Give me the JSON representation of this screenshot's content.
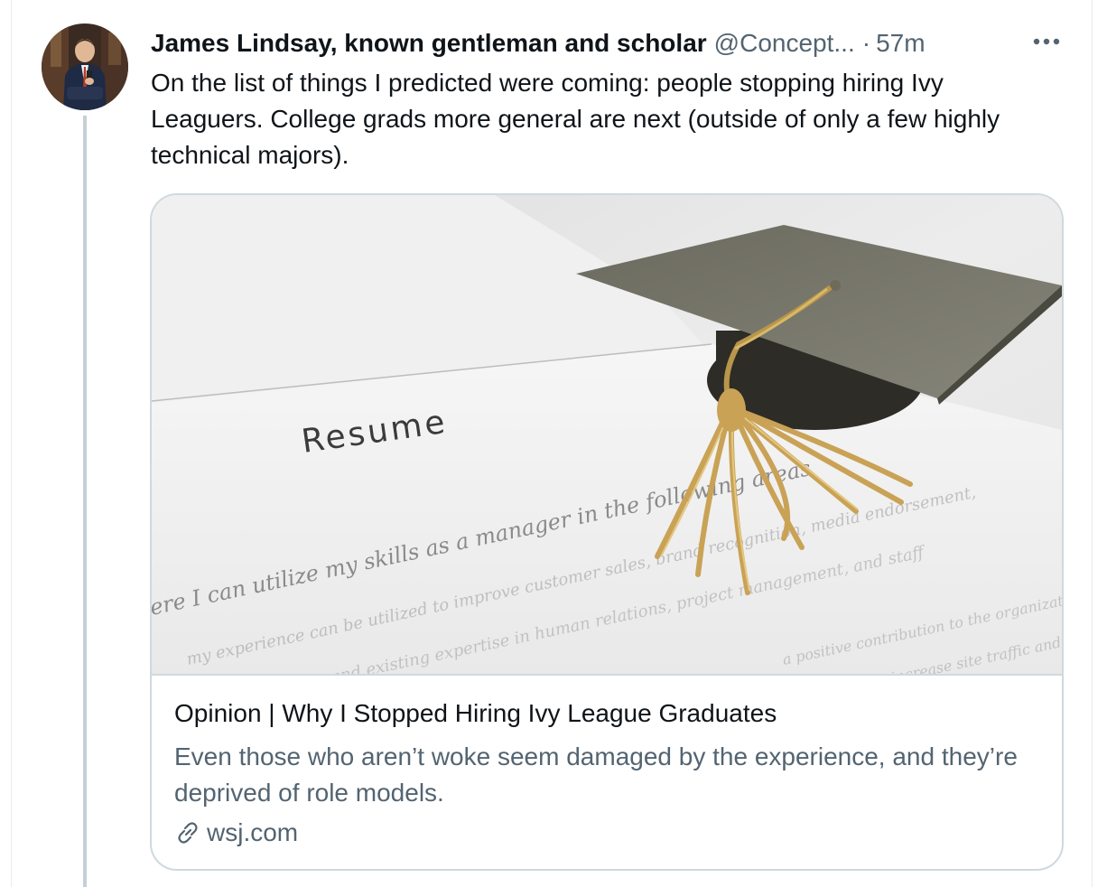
{
  "tweet": {
    "author_name": "James Lindsay, known gentleman and scholar",
    "handle": "@Concept...",
    "separator": "·",
    "time": "57m",
    "text": "On the list of things I predicted were coming: people stopping hiring Ivy Leaguers. College grads more general are next (outside of only a few highly technical majors).",
    "more_icon": "more-horizontal-icon"
  },
  "card": {
    "image_caption_word": "Resume",
    "image_lines": [
      "ere I can utilize my skills as a manager in the following areas",
      "my experience can be utilized to improve customer sales, brand recognition, media endorsement,",
      "and existing expertise in human relations, project management, and staff",
      "a positive contribution to the organization",
      "increase site traffic and"
    ],
    "title": "Opinion | Why I Stopped Hiring Ivy League Graduates",
    "description": "Even those who aren’t woke seem damaged by the experience, and they’re deprived of role models.",
    "domain": "wsj.com",
    "domain_icon": "link-icon"
  },
  "colors": {
    "text_primary": "#0f1419",
    "text_secondary": "#536471",
    "border": "#cfd9de",
    "thread_line": "#c4cfd6"
  }
}
